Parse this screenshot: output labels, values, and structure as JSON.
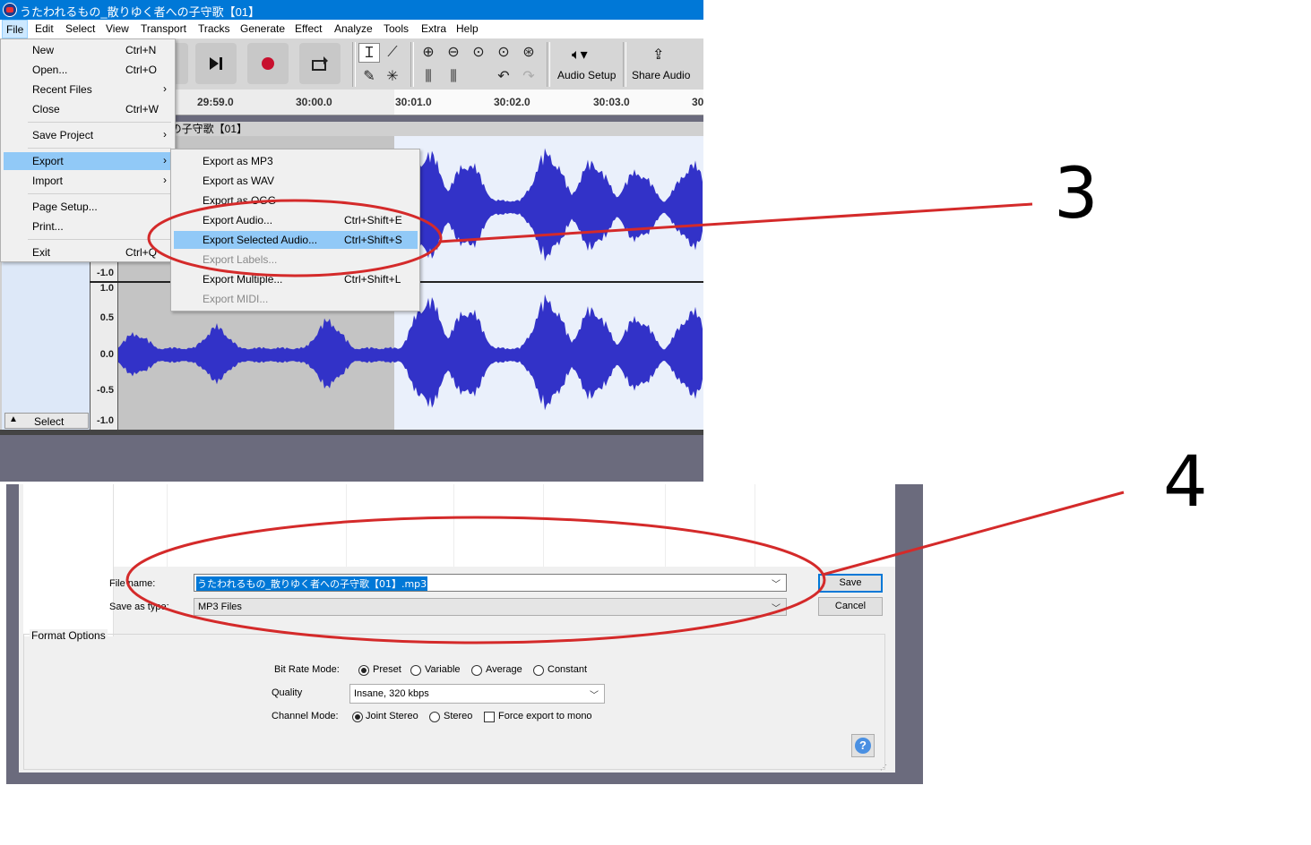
{
  "window": {
    "title": "うたわれるもの_散りゆく者への子守歌【01】"
  },
  "menubar": [
    "File",
    "Edit",
    "Select",
    "View",
    "Transport",
    "Tracks",
    "Generate",
    "Effect",
    "Analyze",
    "Tools",
    "Extra",
    "Help"
  ],
  "toolbar": {
    "audio_setup": "Audio Setup",
    "share_audio": "Share Audio"
  },
  "ruler": {
    "ticks": [
      "29:59.0",
      "30:00.0",
      "30:01.0",
      "30:02.0",
      "30:03.0",
      "30"
    ]
  },
  "track": {
    "clip_name": "の_散りゆく者への子守歌【01】",
    "vscale": [
      "-1.0",
      "1.0",
      "0.5",
      "0.0",
      "-0.5",
      "-1.0"
    ],
    "select_button": "Select"
  },
  "file_menu": {
    "items": [
      {
        "label": "New",
        "shortcut": "Ctrl+N"
      },
      {
        "label": "Open...",
        "shortcut": "Ctrl+O"
      },
      {
        "label": "Recent Files",
        "shortcut": ""
      },
      {
        "label": "Close",
        "shortcut": "Ctrl+W"
      },
      {
        "label": "Save Project",
        "shortcut": ""
      },
      {
        "label": "Export",
        "shortcut": ""
      },
      {
        "label": "Import",
        "shortcut": ""
      },
      {
        "label": "Page Setup...",
        "shortcut": ""
      },
      {
        "label": "Print...",
        "shortcut": ""
      },
      {
        "label": "Exit",
        "shortcut": "Ctrl+Q"
      }
    ]
  },
  "export_menu": {
    "items": [
      {
        "label": "Export as MP3",
        "shortcut": ""
      },
      {
        "label": "Export as WAV",
        "shortcut": ""
      },
      {
        "label": "Export as OGG",
        "shortcut": ""
      },
      {
        "label": "Export Audio...",
        "shortcut": "Ctrl+Shift+E"
      },
      {
        "label": "Export Selected Audio...",
        "shortcut": "Ctrl+Shift+S"
      },
      {
        "label": "Export Labels...",
        "shortcut": ""
      },
      {
        "label": "Export Multiple...",
        "shortcut": "Ctrl+Shift+L"
      },
      {
        "label": "Export MIDI...",
        "shortcut": ""
      }
    ]
  },
  "dialog": {
    "file_name_label": "File name:",
    "file_name_value": "うたわれるもの_散りゆく者への子守歌【01】.mp3",
    "save_as_type_label": "Save as type:",
    "save_as_type_value": "MP3 Files",
    "save_button": "Save",
    "cancel_button": "Cancel",
    "format_options_title": "Format Options",
    "bit_rate_mode_label": "Bit Rate Mode:",
    "bit_rate_modes": [
      "Preset",
      "Variable",
      "Average",
      "Constant"
    ],
    "quality_label": "Quality",
    "quality_value": "Insane, 320 kbps",
    "channel_mode_label": "Channel Mode:",
    "channel_modes": [
      "Joint Stereo",
      "Stereo"
    ],
    "force_mono_label": "Force export to mono"
  },
  "annotations": {
    "step3": "3",
    "step4": "4",
    "color": "#d42a2a"
  }
}
